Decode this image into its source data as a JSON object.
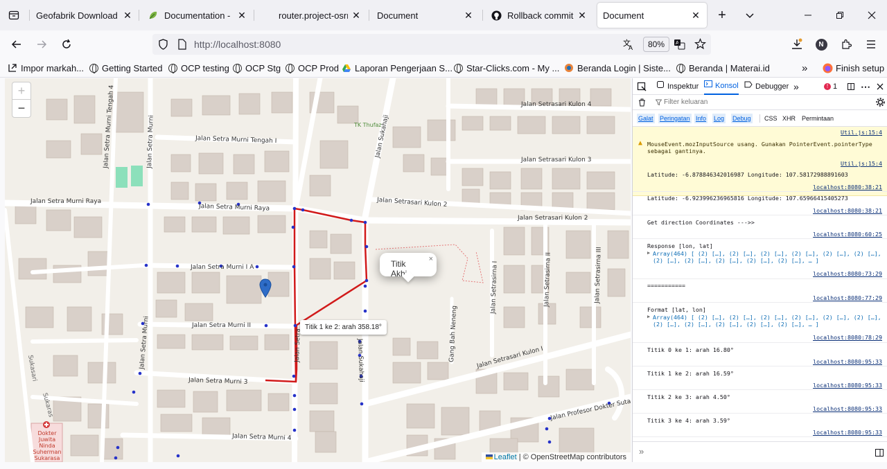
{
  "tabs": [
    {
      "title": "Geofabrik Download Se",
      "icon": "geofabrik-icon"
    },
    {
      "title": "Documentation - Le",
      "icon": "leaflet-leaf-icon"
    },
    {
      "title": "router.project-osrm",
      "icon": "blank-page-icon"
    },
    {
      "title": "Document",
      "icon": "blank-page-icon"
    },
    {
      "title": "Rollback commit se",
      "icon": "github-icon"
    },
    {
      "title": "Document",
      "icon": "blank-page-icon"
    }
  ],
  "nav": {
    "url_host": "http://localhost",
    "url_port": ":8080",
    "zoom": "80%"
  },
  "bookmarks": [
    {
      "label": "Impor markah...",
      "icon": "import-icon"
    },
    {
      "label": "Getting Started",
      "icon": "globe-icon"
    },
    {
      "label": "OCP testing",
      "icon": "globe-icon"
    },
    {
      "label": "OCP Stg",
      "icon": "globe-icon"
    },
    {
      "label": "OCP Prod",
      "icon": "globe-icon"
    },
    {
      "label": "Laporan Pengerjaan S...",
      "icon": "google-drive-icon"
    },
    {
      "label": "Star-Clicks.com - My ...",
      "icon": "globe-icon"
    },
    {
      "label": "Beranda Login | Siste...",
      "icon": "site-icon"
    },
    {
      "label": "Beranda | Materai.id",
      "icon": "globe-icon"
    }
  ],
  "finish_setup": "Finish setup",
  "map": {
    "zoom_in": "+",
    "zoom_out": "−",
    "popup": "Titik Akhir",
    "tooltip": "Titik 1 ke 2: arah 358.18°",
    "attribution_leaflet": "Leaflet",
    "attribution_rest": "| © OpenStreetMap contributors",
    "streets": [
      "Jalan Setra Murni Tengah I",
      "Jalan Setra Murni Raya",
      "Jalan Setra Murni Raya",
      "Jalan Setra Murni I A",
      "Jalan Setra Murni II",
      "Jalan Setra Murni 3",
      "Jalan Setra Murni 4",
      "Jalan Setra Murni",
      "Jalan Setra Murni",
      "Jalan Setra Murni Tengah 4",
      "Jalan Setrasari Kulon 4",
      "Jalan Setrasari Kulon 3",
      "Jalan Setrasari Kulon 2",
      "Jalan Setrasari Kulon 2",
      "Jalan Setrasari Kulon I",
      "Jalan Setrasirna I",
      "Jalan Setrasirna II",
      "Jalan Setrasirna III",
      "Jalan Sukahaji",
      "Jalan Sukahaji",
      "Gang Bah Neneng",
      "Jalan Profesor Dokter Sutan",
      "TK Thufaz",
      "Jalan Setra",
      "Sukasari",
      "Sukaras"
    ],
    "hospital": [
      "Dokter",
      "Juwita",
      "Ninda",
      "Suherman",
      "Sukarasa"
    ]
  },
  "devtools": {
    "tabs": [
      "Inspektur",
      "Konsol",
      "Debugger"
    ],
    "error_count": "1",
    "filter_placeholder": "Filter keluaran",
    "levels": [
      "Galat",
      "Peringatan",
      "Info",
      "Log",
      "Debug",
      "CSS",
      "XHR",
      "Permintaan"
    ],
    "messages": [
      {
        "text": "",
        "src": "Util.js:15:4"
      },
      {
        "text": "MouseEvent.mozInputSource usang. Gunakan PointerEvent.pointerType\nsebagai gantinya.",
        "src": "Util.js:15:4"
      },
      {
        "text": "Latitude: -6.878846342016987 Longitude: 107.58172988891603",
        "src": "localhost:8080:38:21"
      },
      {
        "text": "Latitude: -6.923996236965816 Longitude: 107.65966415405273",
        "src": "localhost:8080:38:21"
      },
      {
        "text": "Get direction Coordinates --->>",
        "src": "localhost:8080:60:25"
      },
      {
        "text": "Response [lon, lat]",
        "sub": "Array(464) [ (2) […], (2) […], (2) […], (2) […], (2) […], (2) […],\n(2) […], (2) […], (2) […], (2) […], (2) […], … ]",
        "src": "localhost:8080:73:29"
      },
      {
        "text": "===========",
        "src": "localhost:8080:77:29"
      },
      {
        "text": "Format [lat, lon]",
        "sub": "Array(464) [ (2) […], (2) […], (2) […], (2) […], (2) […], (2) […],\n(2) […], (2) […], (2) […], (2) […], (2) […], … ]",
        "src": "localhost:8080:78:29"
      },
      {
        "text": "Titik 0 ke 1: arah 16.80°",
        "src": "localhost:8080:95:33"
      },
      {
        "text": "Titik 1 ke 2: arah 16.59°",
        "src": "localhost:8080:95:33"
      },
      {
        "text": "Titik 2 ke 3: arah 4.50°",
        "src": "localhost:8080:95:33"
      },
      {
        "text": "Titik 3 ke 4: arah 3.59°",
        "src": "localhost:8080:95:33"
      }
    ],
    "prompt": "»"
  }
}
